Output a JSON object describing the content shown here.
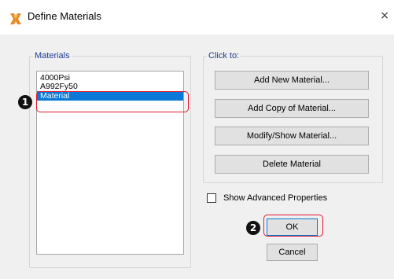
{
  "window": {
    "title": "Define Materials",
    "close_glyph": "×",
    "icon": "app-logo-icon"
  },
  "materials": {
    "legend": "Materials",
    "items": [
      "4000Psi",
      "A992Fy50",
      "Material"
    ],
    "selected": "Material"
  },
  "click_to": {
    "legend": "Click to:",
    "add_new": "Add New Material...",
    "add_copy": "Add Copy of Material...",
    "modify": "Modify/Show Material...",
    "delete": "Delete Material"
  },
  "advanced": {
    "label": "Show Advanced Properties",
    "checked": false
  },
  "buttons": {
    "ok": "OK",
    "cancel": "Cancel"
  },
  "annotations": {
    "badge1": "1",
    "badge2": "2",
    "color": "#e0182a"
  },
  "colors": {
    "selection": "#0a78d7",
    "legend_text": "#1a3d8f",
    "dialog_bg": "#f0f0f0"
  }
}
